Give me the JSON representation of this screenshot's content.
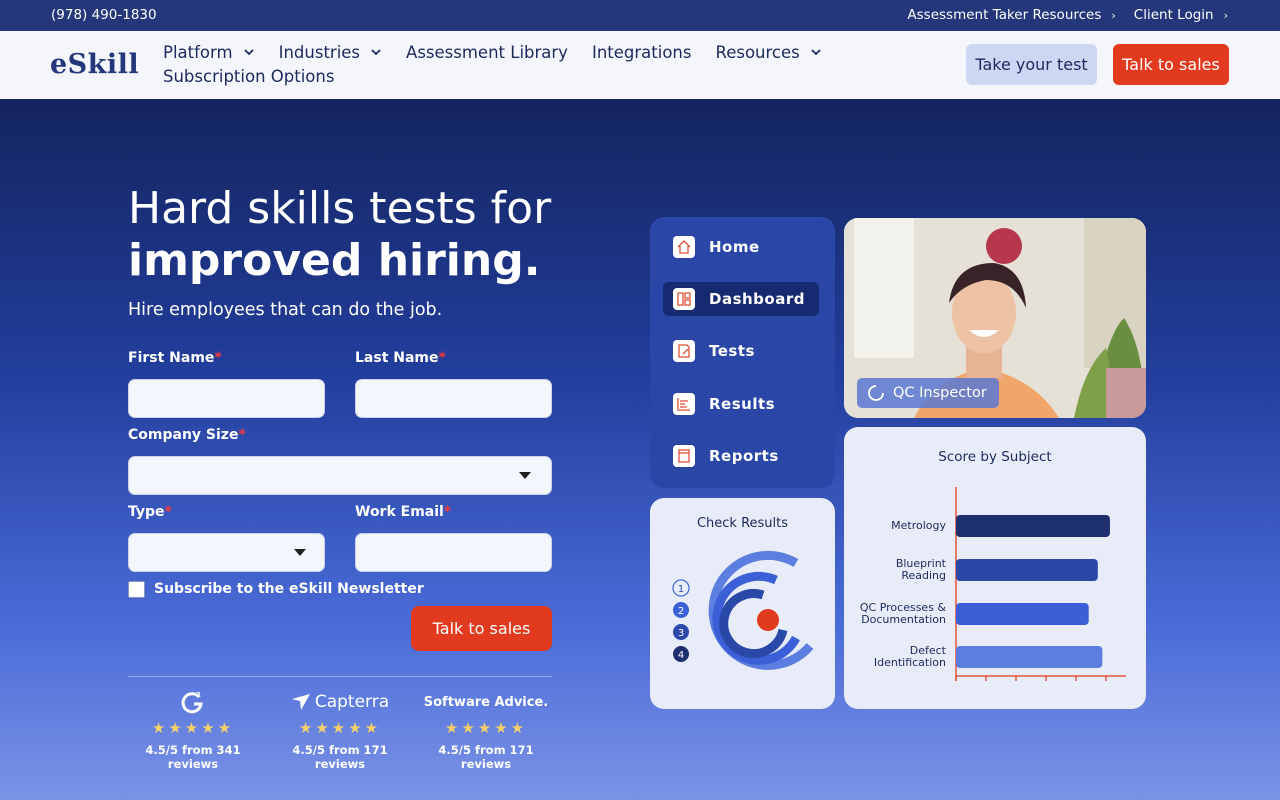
{
  "topbar": {
    "phone": "(978) 490-1830",
    "links": [
      "Assessment Taker Resources",
      "Client Login"
    ]
  },
  "nav": {
    "logo": "eSkill",
    "menu": [
      {
        "label": "Platform",
        "dropdown": true
      },
      {
        "label": "Industries",
        "dropdown": true
      },
      {
        "label": "Assessment Library",
        "dropdown": false
      },
      {
        "label": "Integrations",
        "dropdown": false
      },
      {
        "label": "Resources",
        "dropdown": true
      }
    ],
    "menu_row2": "Subscription Options",
    "take_test": "Take your test",
    "talk_sales": "Talk to sales"
  },
  "hero": {
    "title_line1": "Hard skills tests for",
    "title_line2": "improved hiring.",
    "subtitle": "Hire employees that can do the job."
  },
  "form": {
    "first_name": "First Name",
    "last_name": "Last Name",
    "company_size": "Company Size",
    "type": "Type",
    "work_email": "Work Email",
    "required_mark": "*",
    "newsletter": "Subscribe to the eSkill Newsletter",
    "submit": "Talk to sales"
  },
  "reviews": [
    {
      "brand": "G2",
      "stars": "★★★★★",
      "text": "4.5/5 from 341 reviews"
    },
    {
      "brand": "Capterra",
      "stars": "★★★★★",
      "text": "4.5/5 from 171 reviews"
    },
    {
      "brand": "Software Advice.",
      "stars": "★★★★★",
      "text": "4.5/5 from 171 reviews"
    }
  ],
  "sidebar_mock": {
    "items": [
      "Home",
      "Dashboard",
      "Tests",
      "Results",
      "Reports"
    ],
    "active": "Dashboard"
  },
  "photo_badge": "QC Inspector",
  "check_results": {
    "title": "Check Results",
    "steps": [
      "1",
      "2",
      "3",
      "4"
    ]
  },
  "chart_data": {
    "type": "bar",
    "orientation": "horizontal",
    "title": "Score by Subject",
    "categories": [
      "Metrology",
      "Blueprint Reading",
      "QC Processes & Documentation",
      "Defect Identification"
    ],
    "values": [
      85,
      77,
      71,
      80
    ],
    "xlim": [
      0,
      100
    ],
    "colors": [
      "#1d2f6e",
      "#2a48a8",
      "#3a5fd6",
      "#5b7ee0"
    ]
  },
  "colors": {
    "accent": "#e23a1e",
    "navy": "#24377a"
  }
}
